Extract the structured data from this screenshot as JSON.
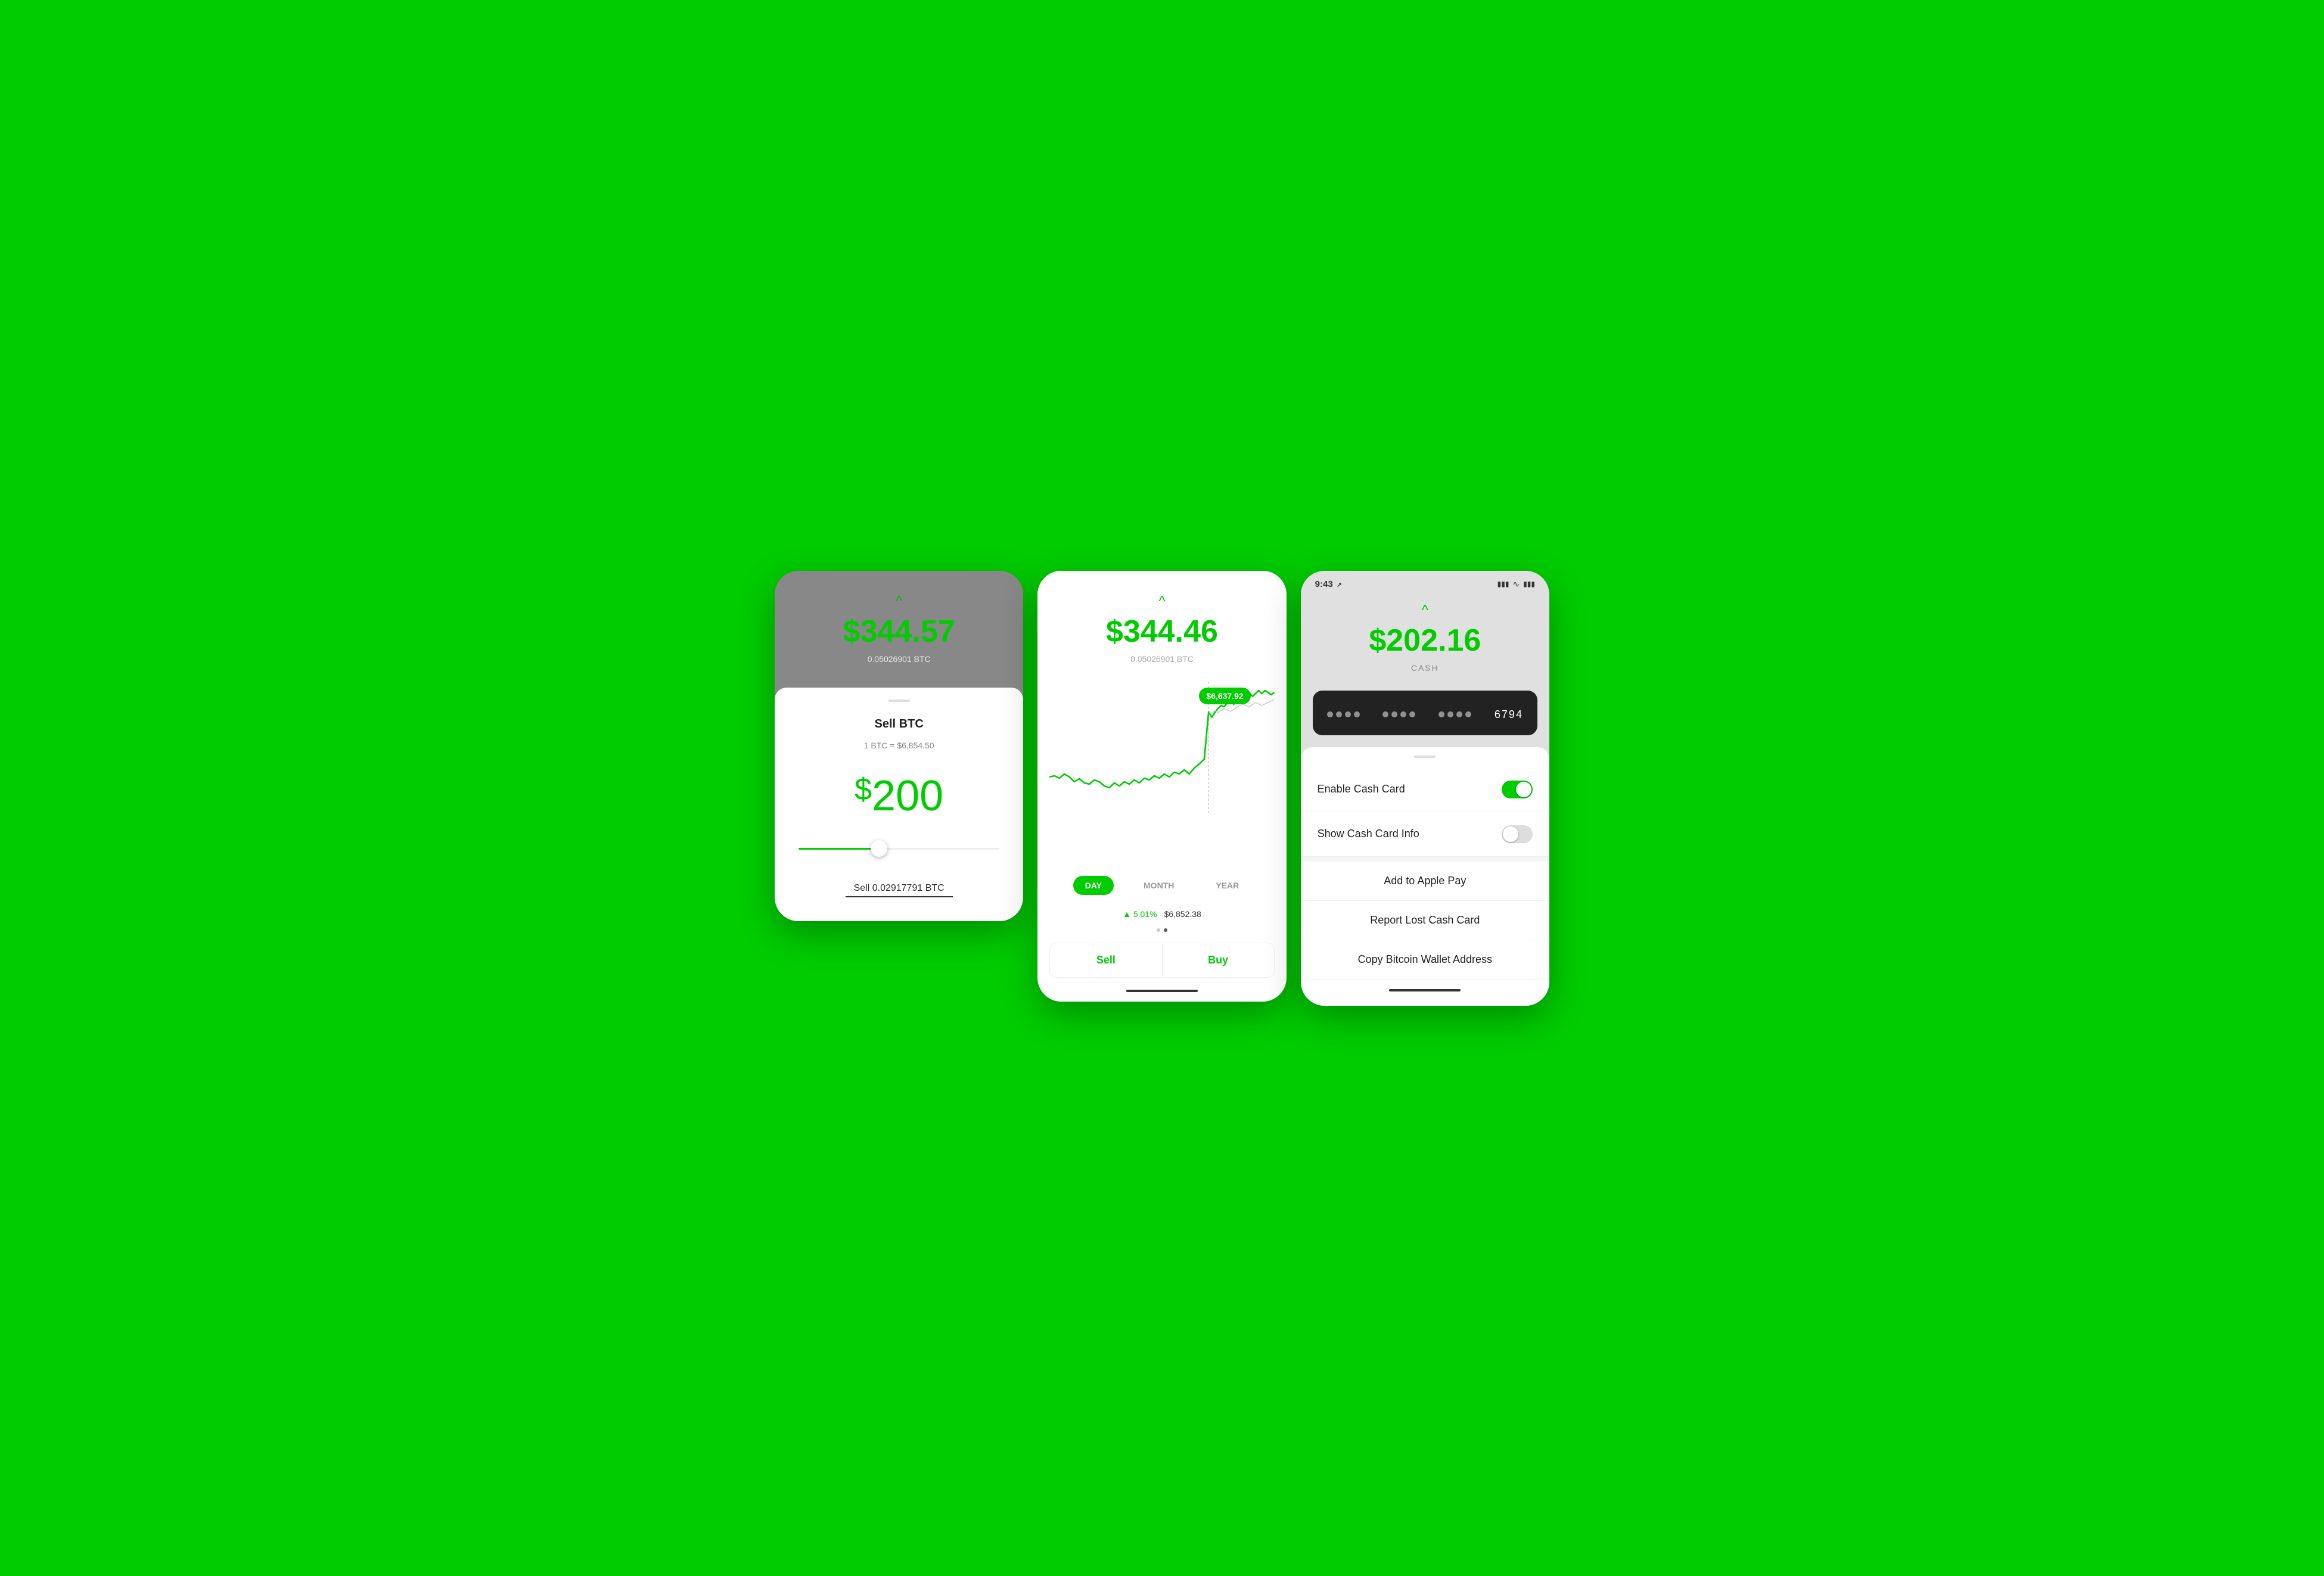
{
  "background_color": "#00CC00",
  "screens": {
    "screen1": {
      "balance": "$344.57",
      "btc_amount": "0.05026901 BTC",
      "title": "Sell BTC",
      "rate": "1 BTC = $6,854.50",
      "amount": "200",
      "slider_position": "40",
      "sell_label": "Sell 0.02917791 BTC"
    },
    "screen2": {
      "balance": "$344.46",
      "btc_amount": "0.05026901 BTC",
      "tooltip_price": "$6,637.92",
      "period_day": "DAY",
      "period_month": "MONTH",
      "period_year": "YEAR",
      "stat_percent": "▲ 5.01%",
      "stat_price": "$6,852.38",
      "sell_btn": "Sell",
      "buy_btn": "Buy"
    },
    "screen3": {
      "status_time": "9:43",
      "balance": "$202.16",
      "balance_label": "CASH",
      "card_last4": "6794",
      "menu_items": [
        {
          "label": "Enable Cash Card",
          "type": "toggle",
          "state": "on"
        },
        {
          "label": "Show Cash Card Info",
          "type": "toggle",
          "state": "off"
        },
        {
          "label": "Add to Apple Pay",
          "type": "action"
        },
        {
          "label": "Report Lost Cash Card",
          "type": "action"
        },
        {
          "label": "Copy Bitcoin Wallet Address",
          "type": "action"
        }
      ]
    }
  },
  "icons": {
    "chevron": "^",
    "signal": "▪▪▪",
    "wifi": "wifi",
    "battery": "▓"
  }
}
